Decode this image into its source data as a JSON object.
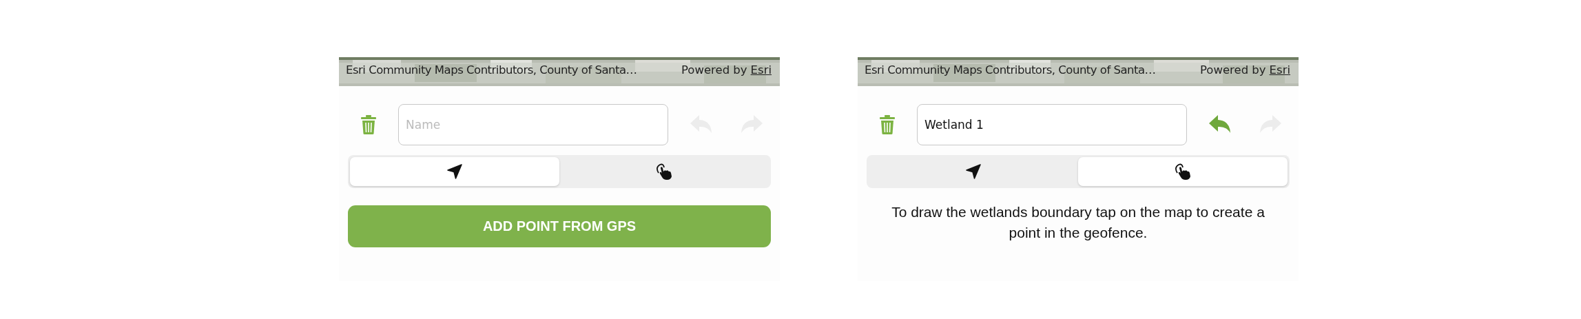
{
  "panels": [
    {
      "map": {
        "attribution": "Esri Community Maps Contributors, County of Santa…",
        "powered_by": "Powered by",
        "link": "Esri"
      },
      "name_field": {
        "placeholder": "Name"
      },
      "undo": {
        "disabled": true
      },
      "redo": {
        "disabled": true
      },
      "segments": [
        {
          "kind": "location",
          "selected": true
        },
        {
          "kind": "touch",
          "selected": false
        }
      ],
      "footer": {
        "kind": "button",
        "text": "ADD POINT FROM GPS"
      }
    },
    {
      "map": {
        "attribution": "Esri Community Maps Contributors, County of Santa…",
        "powered_by": "Powered by",
        "link": "Esri"
      },
      "name_field": {
        "value": "Wetland 1"
      },
      "undo": {
        "disabled": false
      },
      "redo": {
        "disabled": true
      },
      "segments": [
        {
          "kind": "location",
          "selected": false
        },
        {
          "kind": "touch",
          "selected": true
        }
      ],
      "footer": {
        "kind": "instruction",
        "text": "To draw the wetlands boundary tap on the map to create a point in the geofence."
      }
    }
  ]
}
